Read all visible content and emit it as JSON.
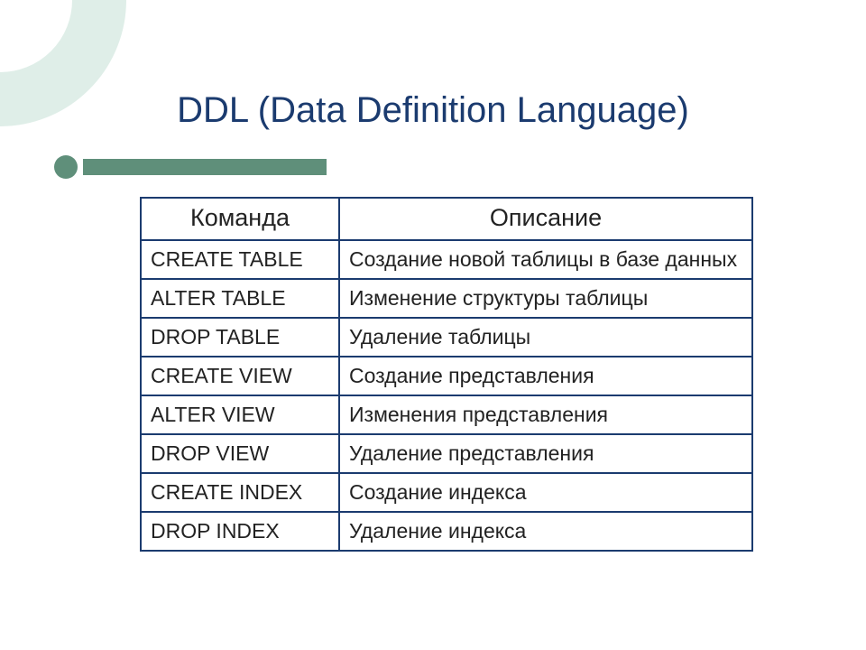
{
  "title": "DDL (Data Definition Language)",
  "colors": {
    "accent": "#1b3b6f",
    "deco": "#dfeee8",
    "bar": "#5f8f7a"
  },
  "table": {
    "headers": {
      "command": "Команда",
      "description": "Описание"
    },
    "rows": [
      {
        "command": "CREATE TABLE",
        "description": "Создание новой таблицы в базе данных"
      },
      {
        "command": "ALTER TABLE",
        "description": "Изменение структуры таблицы"
      },
      {
        "command": "DROP TABLE",
        "description": "Удаление таблицы"
      },
      {
        "command": "CREATE VIEW",
        "description": "Создание представления"
      },
      {
        "command": "ALTER VIEW",
        "description": "Изменения представления"
      },
      {
        "command": "DROP VIEW",
        "description": "Удаление представления"
      },
      {
        "command": "CREATE INDEX",
        "description": "Создание индекса"
      },
      {
        "command": "DROP INDEX",
        "description": "Удаление индекса"
      }
    ]
  }
}
